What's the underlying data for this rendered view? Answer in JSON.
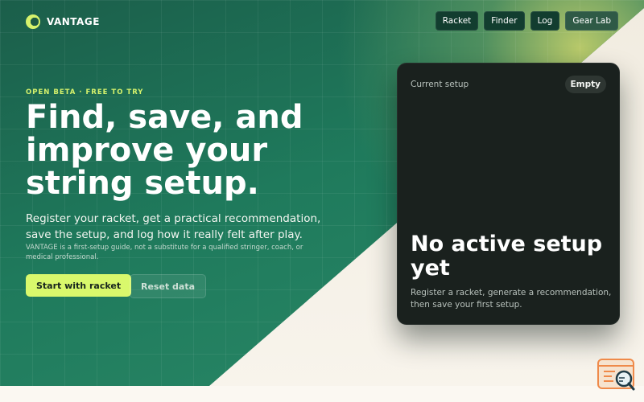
{
  "brand": {
    "name": "VANTAGE",
    "logo_icon": "circle-logo-icon"
  },
  "nav": [
    {
      "label": "Racket"
    },
    {
      "label": "Finder"
    },
    {
      "label": "Log"
    },
    {
      "label": "Gear Lab"
    }
  ],
  "hero": {
    "kicker": "OPEN BETA · FREE TO TRY",
    "headline": "Find, save, and improve your string setup.",
    "lede": "Register your racket, get a practical recommendation, save the setup, and log how it really felt after play.",
    "disclaimer": "VANTAGE is a first-setup guide, not a substitute for a qualified stringer, coach, or medical professional.",
    "cta_primary": "Start with racket",
    "cta_secondary": "Reset data"
  },
  "setup_card": {
    "label": "Current setup",
    "status": "Empty",
    "title": "No active setup yet",
    "description": "Register a racket, generate a recommendation, then save your first setup."
  },
  "colors": {
    "accent": "#d9f86c",
    "hero_green": "#1f7a5c",
    "card_dark": "#1a211e",
    "page_cream": "#f7f3ea"
  },
  "helper_widget": {
    "icon": "search-browser-icon"
  }
}
